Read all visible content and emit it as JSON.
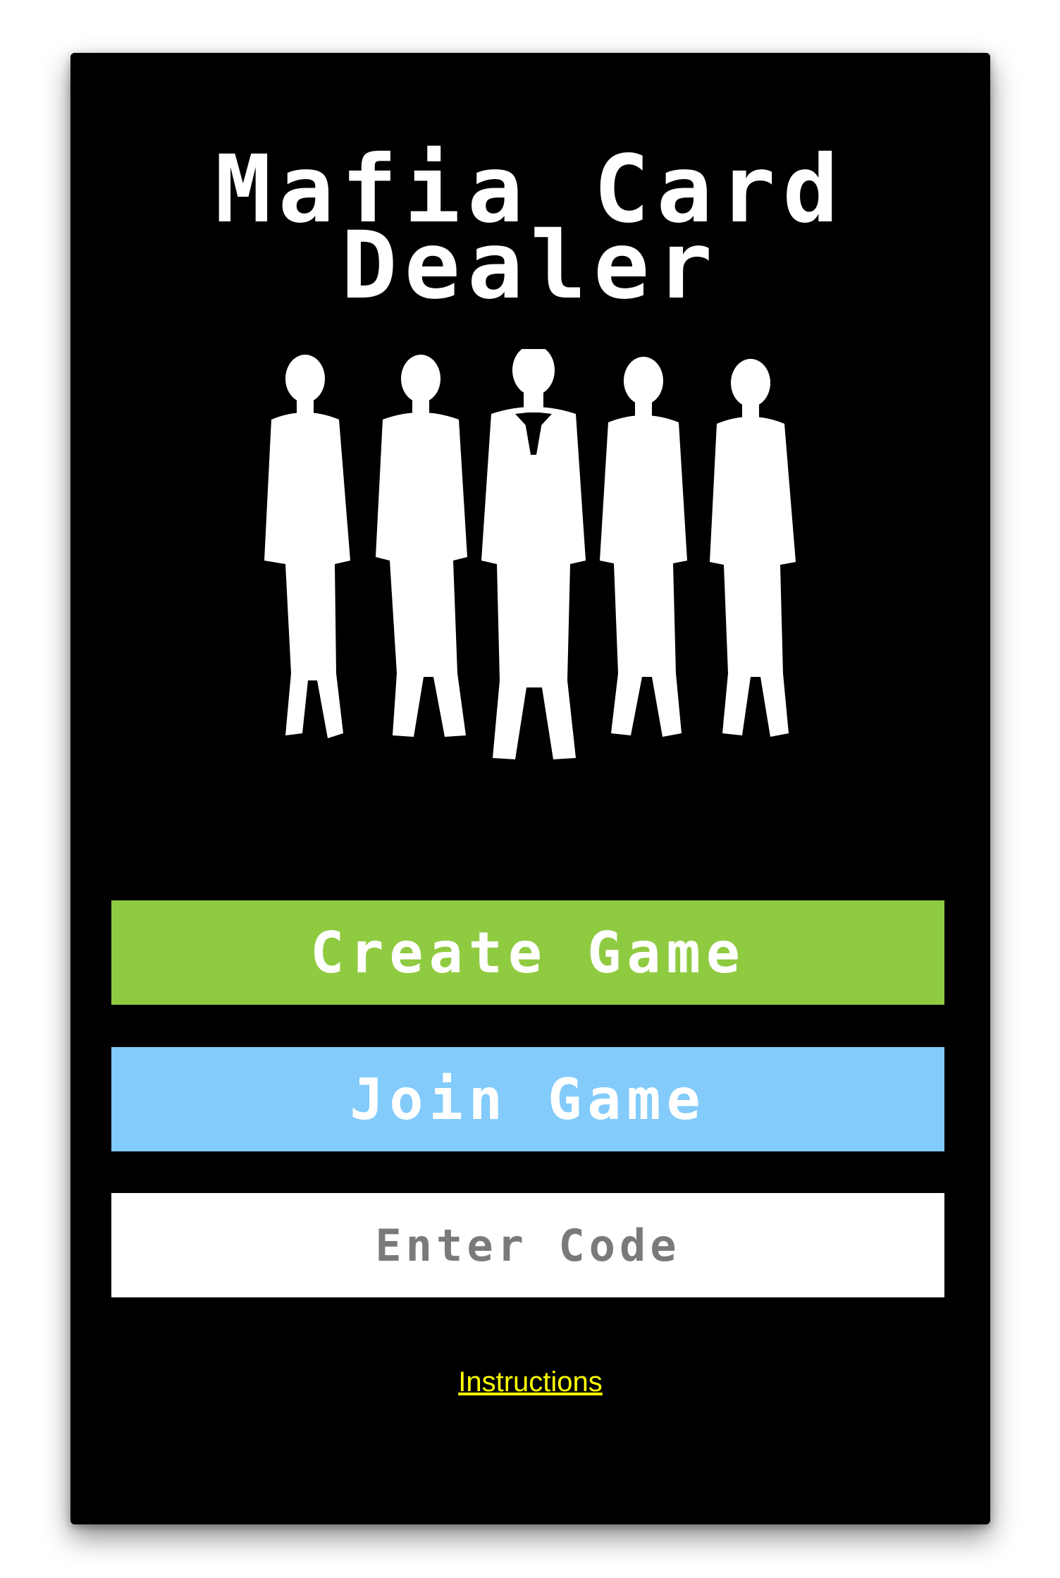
{
  "app": {
    "title_line1": "Mafia Card",
    "title_line2": "Dealer"
  },
  "hero": {
    "icon": "mafia-silhouettes-icon"
  },
  "buttons": {
    "create_label": "Create Game",
    "join_label": "Join Game"
  },
  "code_field": {
    "placeholder": "Enter Code",
    "value": ""
  },
  "links": {
    "instructions": "Instructions"
  },
  "colors": {
    "background": "#000000",
    "create": "#8fcb41",
    "join": "#82cbfb",
    "link": "#ffff00",
    "text": "#ffffff"
  }
}
